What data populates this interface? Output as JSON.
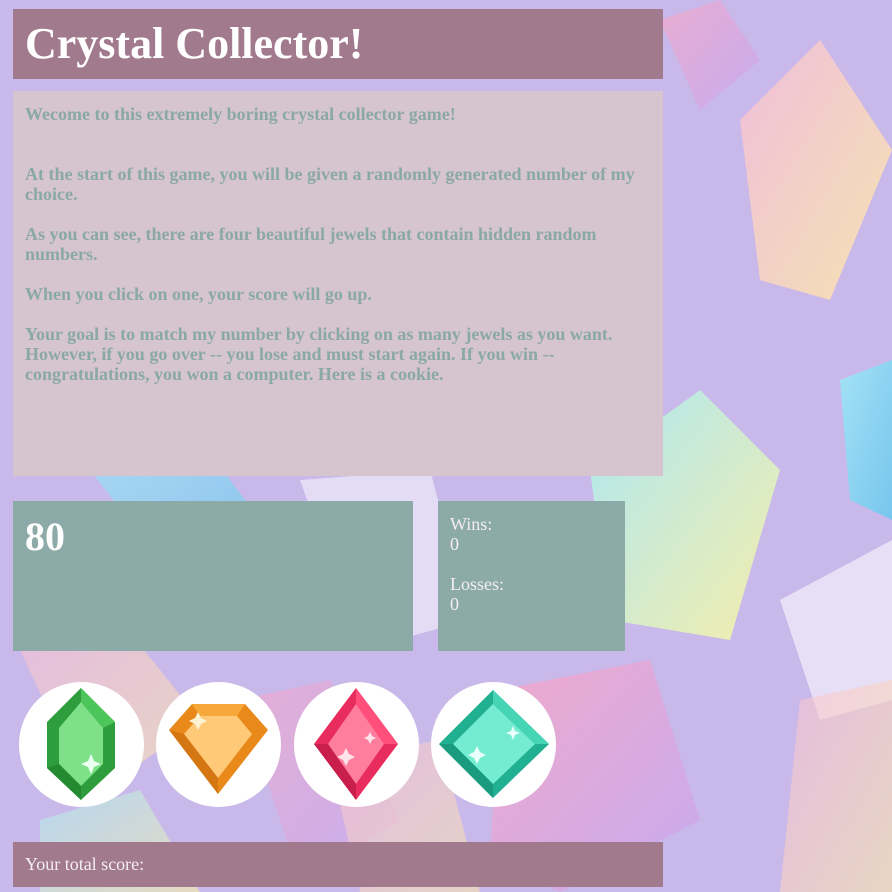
{
  "header": {
    "title": "Crystal Collector!"
  },
  "intro": {
    "paragraphs": [
      "Wecome to this extremely boring crystal collector game!",
      "At the start of this game, you will be given a randomly generated number of my choice.",
      "As you can see, there are four beautiful jewels that contain hidden random numbers.",
      "When you click on one, your score will go up.",
      "Your goal is to match my number by clicking on as many jewels as you want. However, if you go over -- you lose and must start again. If you win -- congratulations, you won a computer. Here is a cookie."
    ]
  },
  "target": {
    "number": "80"
  },
  "record": {
    "wins_label": "Wins:",
    "wins_value": "0",
    "losses_label": "Losses:",
    "losses_value": "0"
  },
  "crystals": [
    {
      "icon": "green-crystal-icon",
      "color": "#3cb54a"
    },
    {
      "icon": "orange-crystal-icon",
      "color": "#f29a1f"
    },
    {
      "icon": "pink-crystal-icon",
      "color": "#f0426e"
    },
    {
      "icon": "teal-crystal-icon",
      "color": "#3fd1b4"
    }
  ],
  "score": {
    "label": "Your total score:",
    "value": ""
  },
  "colors": {
    "panel_mauve": "#a27a8e",
    "panel_teal": "#8caaa8",
    "intro_bg": "#d6c4ce",
    "intro_text": "#8aa8a6",
    "page_bg": "#c9b8ea"
  }
}
